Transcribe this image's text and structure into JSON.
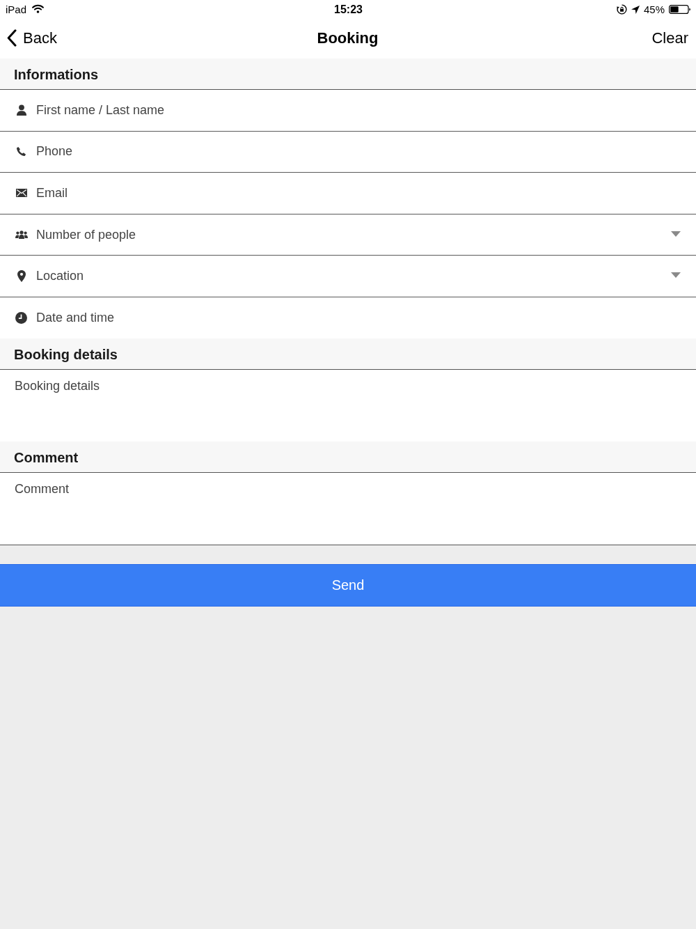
{
  "status_bar": {
    "device": "iPad",
    "time": "15:23",
    "battery": "45%"
  },
  "nav_bar": {
    "back": "Back",
    "title": "Booking",
    "action": "Clear"
  },
  "sections": [
    {
      "title": "Informations",
      "kind": "fields",
      "fields": [
        {
          "kind": "input",
          "placeholder": "First name / Last name"
        },
        {
          "kind": "input",
          "placeholder": "Phone"
        },
        {
          "kind": "input",
          "placeholder": "Email"
        },
        {
          "kind": "select",
          "placeholder": "Number of people"
        },
        {
          "kind": "select",
          "placeholder": "Location"
        },
        {
          "kind": "input",
          "placeholder": "Date and time"
        }
      ]
    },
    {
      "title": "Booking details",
      "kind": "textarea",
      "placeholder": "Booking details"
    },
    {
      "title": "Comment",
      "kind": "textarea",
      "placeholder": "Comment"
    }
  ],
  "send_button": {
    "label": "Send"
  }
}
